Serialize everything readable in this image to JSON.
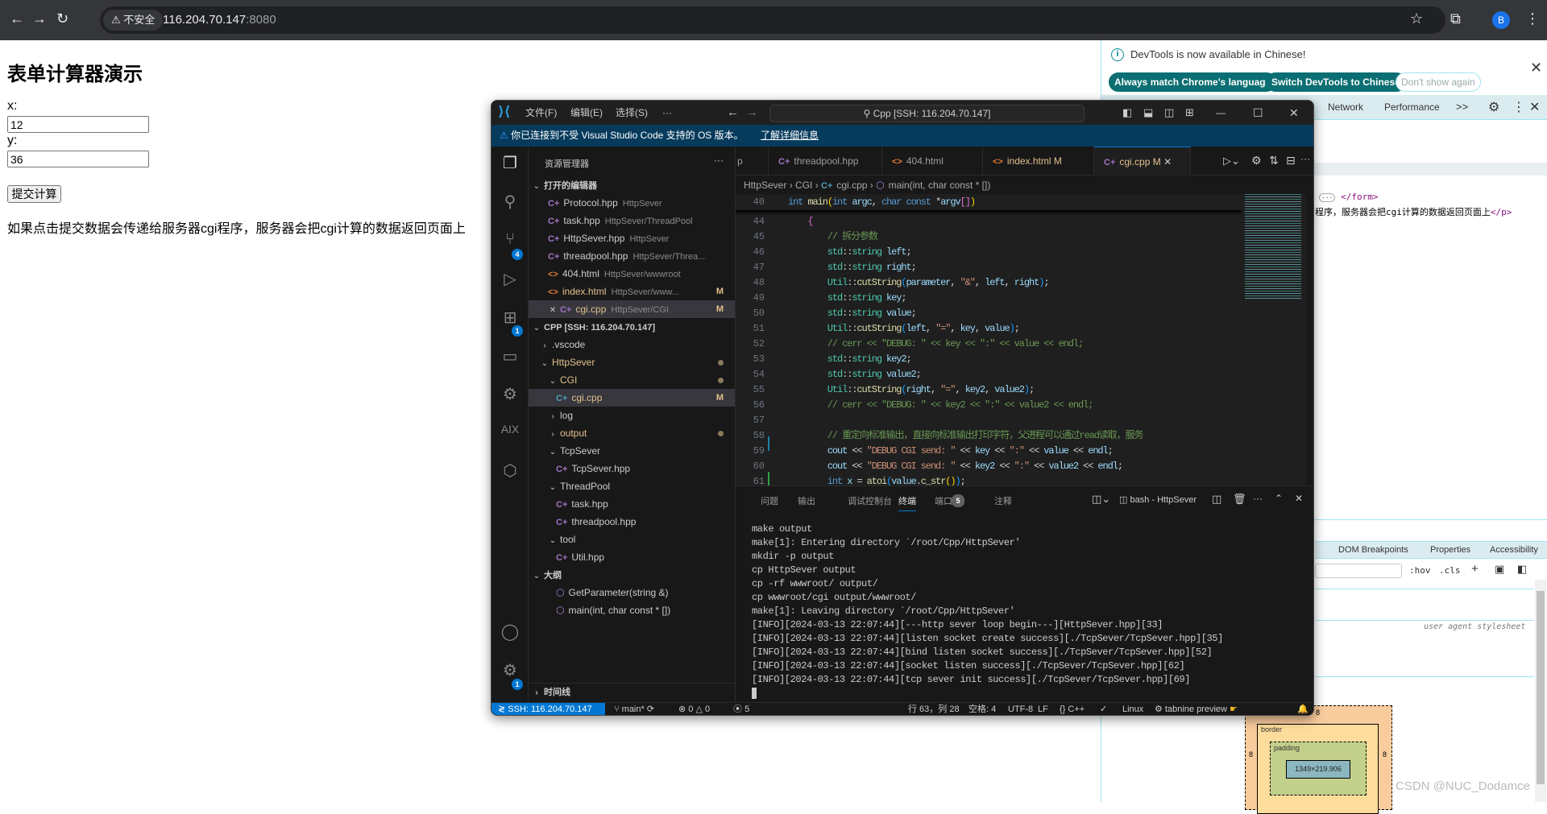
{
  "browser": {
    "security_label": "不安全",
    "url_host": "116.204.70.147",
    "url_port": ":8080",
    "avatar_letter": "B"
  },
  "page": {
    "title": "表单计算器演示",
    "x_label": "x:",
    "x_value": "12",
    "y_label": "y:",
    "y_value": "36",
    "submit_label": "提交计算",
    "paragraph": "如果点击提交数据会传递给服务器cgi程序，服务器会把cgi计算的数据返回页面上"
  },
  "devtools": {
    "info_text": "DevTools is now available in Chinese!",
    "btn_match": "Always match Chrome's language",
    "btn_switch": "Switch DevTools to Chinese",
    "btn_dont_show": "Don't show again",
    "tabs": [
      "Network",
      "Performance"
    ],
    "more_tabs": ">>",
    "elements": {
      "form_close": "</form>",
      "p_text": "程序，服务器会把cgi计算的数据返回页面上",
      "p_close": "</p>"
    },
    "lower_tabs": [
      "DOM Breakpoints",
      "Properties",
      "Accessibility"
    ],
    "hov": ":hov",
    "cls": ".cls",
    "ua_stylesheet": "user agent stylesheet",
    "box_model": {
      "margin": "8",
      "border_label": "border",
      "padding_label": "padding",
      "dash": "–",
      "content_size": "1349×219.906"
    }
  },
  "watermark": "CSDN @NUC_Dodamce",
  "vscode": {
    "menus": [
      "文件(F)",
      "编辑(E)",
      "选择(S)",
      "···"
    ],
    "search": "Cpp [SSH: 116.204.70.147]",
    "warning": "你已连接到不受 Visual Studio Code 支持的 OS 版本。",
    "warning_link": "了解详细信息",
    "activity_badges": {
      "scm": "4",
      "extensions": "1",
      "settings": "1"
    },
    "sidebar": {
      "title": "资源管理器",
      "timeline": "时间线",
      "rows": [
        {
          "label": "打开的编辑器",
          "kind": "header",
          "indent": 0
        },
        {
          "label": "Protocol.hpp",
          "desc": "HttpSever",
          "kind": "cpp",
          "indent": 2
        },
        {
          "label": "task.hpp",
          "desc": "HttpSever/ThreadPool",
          "kind": "cpp",
          "indent": 2
        },
        {
          "label": "HttpSever.hpp",
          "desc": "HttpSever",
          "kind": "cpp",
          "indent": 2
        },
        {
          "label": "threadpool.hpp",
          "desc": "HttpSever/Threa...",
          "kind": "cpp",
          "indent": 2
        },
        {
          "label": "404.html",
          "desc": "HttpSever/wwwroot",
          "kind": "html",
          "indent": 2
        },
        {
          "label": "index.html",
          "desc": "HttpSever/www...",
          "kind": "html",
          "indent": 2,
          "mod": true,
          "badge": "M"
        },
        {
          "label": "cgi.cpp",
          "desc": "HttpSever/CGI",
          "kind": "cpp",
          "indent": 2,
          "mod": true,
          "badge": "M",
          "close": true,
          "sel": true
        },
        {
          "label": "CPP [SSH: 116.204.70.147]",
          "kind": "header",
          "indent": 0
        },
        {
          "label": ".vscode",
          "kind": "folder-closed",
          "indent": 1
        },
        {
          "label": "HttpSever",
          "kind": "folder-open",
          "indent": 1,
          "mod": true,
          "dot": true
        },
        {
          "label": "CGI",
          "kind": "folder-open",
          "indent": 2,
          "mod": true,
          "dot": true
        },
        {
          "label": "cgi.cpp",
          "kind": "cpp",
          "indent": 3,
          "mod": true,
          "badge": "M",
          "sel": true
        },
        {
          "label": "log",
          "kind": "folder-closed",
          "indent": 2
        },
        {
          "label": "output",
          "kind": "folder-closed",
          "indent": 2,
          "mod": true,
          "dot": true
        },
        {
          "label": "TcpSever",
          "kind": "folder-open",
          "indent": 2
        },
        {
          "label": "TcpSever.hpp",
          "kind": "cpp",
          "indent": 3
        },
        {
          "label": "ThreadPool",
          "kind": "folder-open",
          "indent": 2
        },
        {
          "label": "task.hpp",
          "kind": "cpp",
          "indent": 3
        },
        {
          "label": "threadpool.hpp",
          "kind": "cpp",
          "indent": 3
        },
        {
          "label": "tool",
          "kind": "folder-open",
          "indent": 2
        },
        {
          "label": "Util.hpp",
          "kind": "cpp",
          "indent": 3
        },
        {
          "label": "大纲",
          "kind": "header",
          "indent": 0
        },
        {
          "label": "GetParameter(string &)",
          "kind": "symbol",
          "indent": 3
        },
        {
          "label": "main(int, char const * [])",
          "kind": "symbol",
          "indent": 3
        }
      ]
    },
    "tabs": [
      {
        "label": "p",
        "kind": "none"
      },
      {
        "label": "threadpool.hpp",
        "kind": "cpp"
      },
      {
        "label": "404.html",
        "kind": "html"
      },
      {
        "label": "index.html",
        "kind": "html",
        "badge": "M"
      },
      {
        "label": "cgi.cpp",
        "kind": "cpp",
        "badge": "M",
        "active": true
      }
    ],
    "breadcrumb": [
      "HttpSever",
      "CGI",
      "cgi.cpp",
      "main(int, char const * [])"
    ],
    "code": [
      {
        "n": "40",
        "t": [
          [
            "int",
            "kw"
          ],
          [
            " ",
            "pn"
          ],
          [
            "main",
            "fn"
          ],
          [
            "(",
            "b1"
          ],
          [
            "int",
            "kw"
          ],
          [
            " ",
            "pn"
          ],
          [
            "argc",
            "var"
          ],
          [
            ", ",
            "pn"
          ],
          [
            "char",
            "kw"
          ],
          [
            " ",
            "pn"
          ],
          [
            "const",
            "kw"
          ],
          [
            " *",
            "pn"
          ],
          [
            "argv",
            "var"
          ],
          [
            "[]",
            "b2"
          ],
          [
            ")",
            "b1"
          ]
        ]
      },
      {
        "n": "44",
        "t": [
          [
            "    {",
            "b2"
          ]
        ]
      },
      {
        "n": "45",
        "t": [
          [
            "        // 拆分参数",
            "cm"
          ]
        ]
      },
      {
        "n": "46",
        "t": [
          [
            "        std",
            "ty"
          ],
          [
            "::",
            "pn"
          ],
          [
            "string",
            "ty"
          ],
          [
            " ",
            "pn"
          ],
          [
            "left",
            "var"
          ],
          [
            ";",
            "pn"
          ]
        ]
      },
      {
        "n": "47",
        "t": [
          [
            "        std",
            "ty"
          ],
          [
            "::",
            "pn"
          ],
          [
            "string",
            "ty"
          ],
          [
            " ",
            "pn"
          ],
          [
            "right",
            "var"
          ],
          [
            ";",
            "pn"
          ]
        ]
      },
      {
        "n": "48",
        "t": [
          [
            "        Util",
            "ty"
          ],
          [
            "::",
            "pn"
          ],
          [
            "cutString",
            "fn"
          ],
          [
            "(",
            "b3"
          ],
          [
            "parameter",
            "var"
          ],
          [
            ", ",
            "pn"
          ],
          [
            "\"&\"",
            "str"
          ],
          [
            ", ",
            "pn"
          ],
          [
            "left",
            "var"
          ],
          [
            ", ",
            "pn"
          ],
          [
            "right",
            "var"
          ],
          [
            ")",
            "b3"
          ],
          [
            ";",
            "pn"
          ]
        ]
      },
      {
        "n": "49",
        "t": [
          [
            "        std",
            "ty"
          ],
          [
            "::",
            "pn"
          ],
          [
            "string",
            "ty"
          ],
          [
            " ",
            "pn"
          ],
          [
            "key",
            "var"
          ],
          [
            ";",
            "pn"
          ]
        ]
      },
      {
        "n": "50",
        "t": [
          [
            "        std",
            "ty"
          ],
          [
            "::",
            "pn"
          ],
          [
            "string",
            "ty"
          ],
          [
            " ",
            "pn"
          ],
          [
            "value",
            "var"
          ],
          [
            ";",
            "pn"
          ]
        ]
      },
      {
        "n": "51",
        "t": [
          [
            "        Util",
            "ty"
          ],
          [
            "::",
            "pn"
          ],
          [
            "cutString",
            "fn"
          ],
          [
            "(",
            "b3"
          ],
          [
            "left",
            "var"
          ],
          [
            ", ",
            "pn"
          ],
          [
            "\"=\"",
            "str"
          ],
          [
            ", ",
            "pn"
          ],
          [
            "key",
            "var"
          ],
          [
            ", ",
            "pn"
          ],
          [
            "value",
            "var"
          ],
          [
            ")",
            "b3"
          ],
          [
            ";",
            "pn"
          ]
        ]
      },
      {
        "n": "52",
        "t": [
          [
            "        // cerr << \"DEBUG: \" << key << \":\" << value << endl;",
            "cm"
          ]
        ]
      },
      {
        "n": "53",
        "t": [
          [
            "        std",
            "ty"
          ],
          [
            "::",
            "pn"
          ],
          [
            "string",
            "ty"
          ],
          [
            " ",
            "pn"
          ],
          [
            "key2",
            "var"
          ],
          [
            ";",
            "pn"
          ]
        ]
      },
      {
        "n": "54",
        "t": [
          [
            "        std",
            "ty"
          ],
          [
            "::",
            "pn"
          ],
          [
            "string",
            "ty"
          ],
          [
            " ",
            "pn"
          ],
          [
            "value2",
            "var"
          ],
          [
            ";",
            "pn"
          ]
        ]
      },
      {
        "n": "55",
        "t": [
          [
            "        Util",
            "ty"
          ],
          [
            "::",
            "pn"
          ],
          [
            "cutString",
            "fn"
          ],
          [
            "(",
            "b3"
          ],
          [
            "right",
            "var"
          ],
          [
            ", ",
            "pn"
          ],
          [
            "\"=\"",
            "str"
          ],
          [
            ", ",
            "pn"
          ],
          [
            "key2",
            "var"
          ],
          [
            ", ",
            "pn"
          ],
          [
            "value2",
            "var"
          ],
          [
            ")",
            "b3"
          ],
          [
            ";",
            "pn"
          ]
        ]
      },
      {
        "n": "56",
        "t": [
          [
            "        // cerr << \"DEBUG: \" << key2 << \":\" << value2 << endl;",
            "cm"
          ]
        ]
      },
      {
        "n": "57",
        "t": [
          [
            "",
            "pn"
          ]
        ]
      },
      {
        "n": "58",
        "t": [
          [
            "        // 重定向标准输出，直接向标准输出打印字符，父进程可以通过read读取，服务",
            "cm"
          ]
        ]
      },
      {
        "n": "59",
        "t": [
          [
            "        cout",
            "var"
          ],
          [
            " << ",
            "pn"
          ],
          [
            "\"DEBUG CGI send: \"",
            "str"
          ],
          [
            " << ",
            "pn"
          ],
          [
            "key",
            "var"
          ],
          [
            " << ",
            "pn"
          ],
          [
            "\":\"",
            "str"
          ],
          [
            " << ",
            "pn"
          ],
          [
            "value",
            "var"
          ],
          [
            " << ",
            "pn"
          ],
          [
            "endl",
            "var"
          ],
          [
            ";",
            "pn"
          ]
        ]
      },
      {
        "n": "60",
        "t": [
          [
            "        cout",
            "var"
          ],
          [
            " << ",
            "pn"
          ],
          [
            "\"DEBUG CGI send: \"",
            "str"
          ],
          [
            " << ",
            "pn"
          ],
          [
            "key2",
            "var"
          ],
          [
            " << ",
            "pn"
          ],
          [
            "\":\"",
            "str"
          ],
          [
            " << ",
            "pn"
          ],
          [
            "value2",
            "var"
          ],
          [
            " << ",
            "pn"
          ],
          [
            "endl",
            "var"
          ],
          [
            ";",
            "pn"
          ]
        ]
      },
      {
        "n": "61",
        "t": [
          [
            "        int",
            "kw"
          ],
          [
            " ",
            "pn"
          ],
          [
            "x",
            "var"
          ],
          [
            " = ",
            "pn"
          ],
          [
            "atoi",
            "fn"
          ],
          [
            "(",
            "b3"
          ],
          [
            "value",
            "var"
          ],
          [
            ".",
            "pn"
          ],
          [
            "c_str",
            "fn"
          ],
          [
            "()",
            "b1"
          ],
          [
            ")",
            "b3"
          ],
          [
            ";",
            "pn"
          ]
        ]
      }
    ],
    "panel": {
      "tabs": [
        "问题",
        "输出",
        "调试控制台",
        "终端",
        "端口",
        "注释"
      ],
      "active_tab": "终端",
      "ports_badge": "5",
      "terminal_name": "bash - HttpSever",
      "terminal_lines": [
        "make output",
        "make[1]: Entering directory `/root/Cpp/HttpSever'",
        "mkdir -p output",
        "cp HttpSever output",
        "cp -rf wwwroot/ output/",
        "cp wwwroot/cgi output/wwwroot/",
        "make[1]: Leaving directory `/root/Cpp/HttpSever'",
        "[INFO][2024-03-13 22:07:44][---http sever loop begin---][HttpSever.hpp][33]",
        "[INFO][2024-03-13 22:07:44][listen socket create success][./TcpSever/TcpSever.hpp][35]",
        "[INFO][2024-03-13 22:07:44][bind listen socket success][./TcpSever/TcpSever.hpp][52]",
        "[INFO][2024-03-13 22:07:44][socket listen success][./TcpSever/TcpSever.hpp][62]",
        "[INFO][2024-03-13 22:07:44][tcp sever init success][./TcpSever/TcpSever.hpp][69]"
      ]
    },
    "status": {
      "remote": "SSH: 116.204.70.147",
      "branch": "main*",
      "errors": "0",
      "warnings": "0",
      "ports": "5",
      "position": "行 63，列 28",
      "spaces": "空格: 4",
      "encoding": "UTF-8",
      "eol": "LF",
      "language": "C++",
      "os": "Linux",
      "tabnine": "tabnine preview"
    }
  },
  "colors": {
    "accent": "#0078d4",
    "modified": "#e2c08d",
    "devtools_button": "#0b6e72"
  }
}
